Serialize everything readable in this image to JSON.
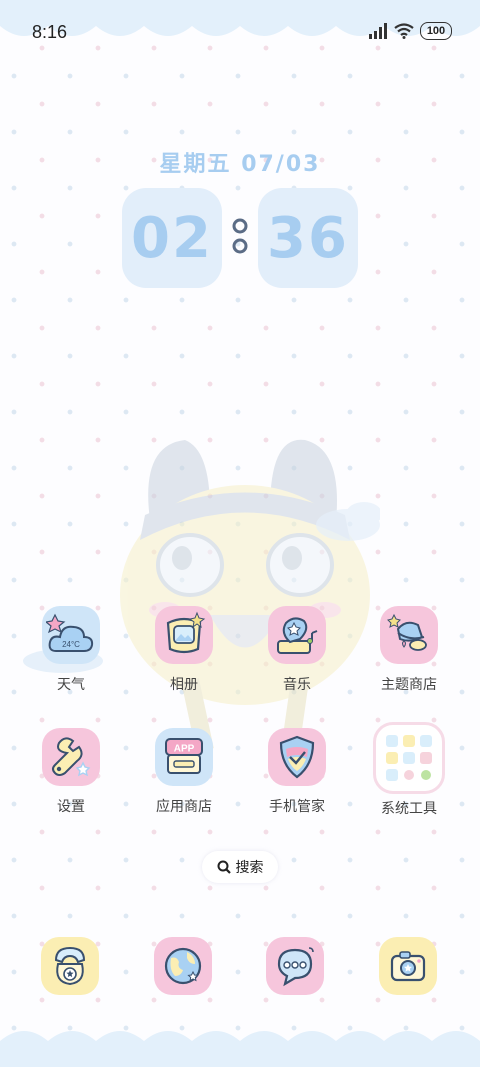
{
  "status_bar": {
    "time": "8:16",
    "battery": "100"
  },
  "clock": {
    "date": "星期五  07/03",
    "hours": "02",
    "minutes": "36"
  },
  "apps": [
    {
      "label": "天气",
      "icon": "weather-icon",
      "temp": "24°C"
    },
    {
      "label": "相册",
      "icon": "gallery-icon"
    },
    {
      "label": "音乐",
      "icon": "music-icon"
    },
    {
      "label": "主题商店",
      "icon": "theme-store-icon"
    },
    {
      "label": "设置",
      "icon": "settings-icon"
    },
    {
      "label": "应用商店",
      "icon": "app-store-icon",
      "badge": "APP"
    },
    {
      "label": "手机管家",
      "icon": "phone-manager-icon"
    },
    {
      "label": "系统工具",
      "icon": "system-tools-folder-icon"
    }
  ],
  "search": {
    "label": "搜索"
  },
  "dock": [
    {
      "icon": "phone-icon"
    },
    {
      "icon": "browser-globe-icon"
    },
    {
      "icon": "messages-icon"
    },
    {
      "icon": "camera-icon"
    }
  ],
  "colors": {
    "accent_blue": "#a7cdf0",
    "pink": "#f6c6dc",
    "yellow": "#fbeeb3",
    "light_blue": "#cfe5f8"
  }
}
